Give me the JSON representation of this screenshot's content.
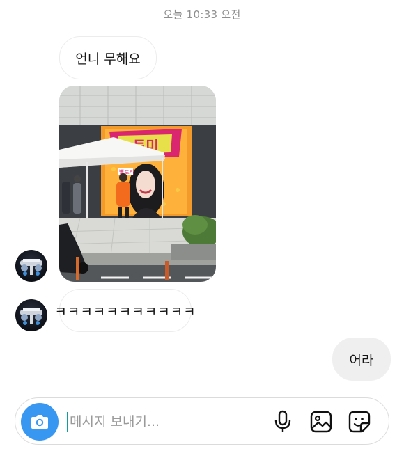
{
  "header": {
    "timestamp": "오늘 10:33 오전"
  },
  "messages": [
    {
      "direction": "incoming",
      "type": "text",
      "text": "언니 무해요"
    },
    {
      "direction": "incoming",
      "type": "photo",
      "photo_text": {
        "banner": "토미",
        "poster_caption": "빨토리"
      }
    },
    {
      "direction": "incoming",
      "type": "text",
      "text": "ㅋㅋㅋㅋㅋㅋㅋㅋㅋㅋㅋ"
    },
    {
      "direction": "outgoing",
      "type": "text",
      "text": "어라"
    }
  ],
  "composer": {
    "placeholder": "메시지 보내기...",
    "icons": [
      "camera-icon",
      "microphone-icon",
      "gallery-icon",
      "sticker-icon"
    ],
    "accent_color": "#3897f0"
  },
  "colors": {
    "incoming_bubble": "#ffffff",
    "outgoing_bubble": "#efefef",
    "timestamp_text": "#8e8e8e"
  }
}
